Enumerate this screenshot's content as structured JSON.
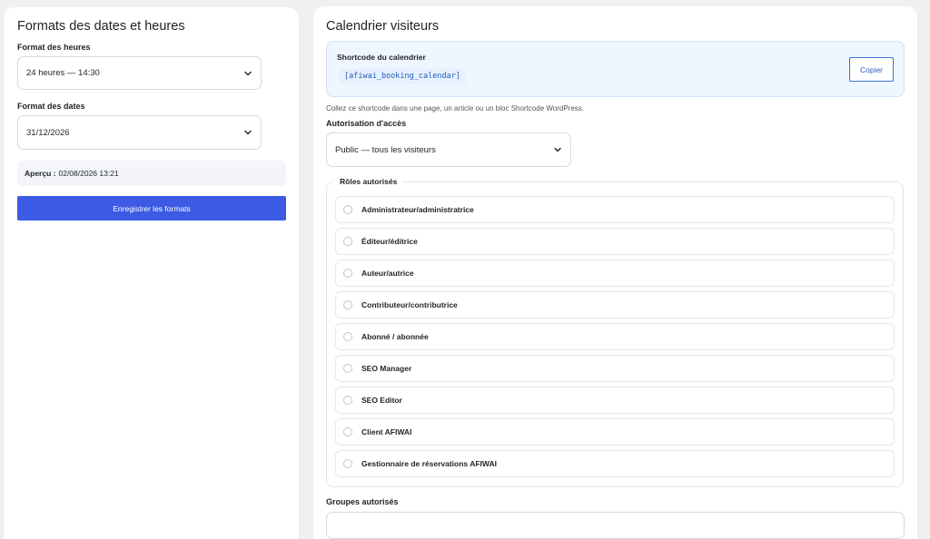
{
  "formats": {
    "title": "Formats des dates et heures",
    "time_label": "Format des heures",
    "time_value": "24 heures — 14:30",
    "date_label": "Format des dates",
    "date_value": "31/12/2026",
    "preview_label": "Aperçu :",
    "preview_value": "02/08/2026 13:21",
    "save_label": "Enregistrer les formats"
  },
  "calendar": {
    "title": "Calendrier visiteurs",
    "shortcode_label": "Shortcode du calendrier",
    "shortcode_value": "[afiwai_booking_calendar]",
    "copy_label": "Copier",
    "help_text": "Collez ce shortcode dans une page, un article ou un bloc Shortcode WordPress.",
    "access_label": "Autorisation d'accès",
    "access_value": "Public — tous les visiteurs",
    "roles_legend": "Rôles autorisés",
    "roles": [
      "Administrateur/administratrice",
      "Éditeur/éditrice",
      "Auteur/autrice",
      "Contributeur/contributrice",
      "Abonné / abonnée",
      "SEO Manager",
      "SEO Editor",
      "Client AFIWAI",
      "Gestionnaire de réservations AFIWAI"
    ],
    "groups_label": "Groupes autorisés"
  },
  "icons": {
    "select_chevron": "chevron-down-icon"
  },
  "colors": {
    "primary": "#3c5ae4",
    "code_text": "#1e5ebd",
    "shortcode_bg": "#eff6fe"
  }
}
